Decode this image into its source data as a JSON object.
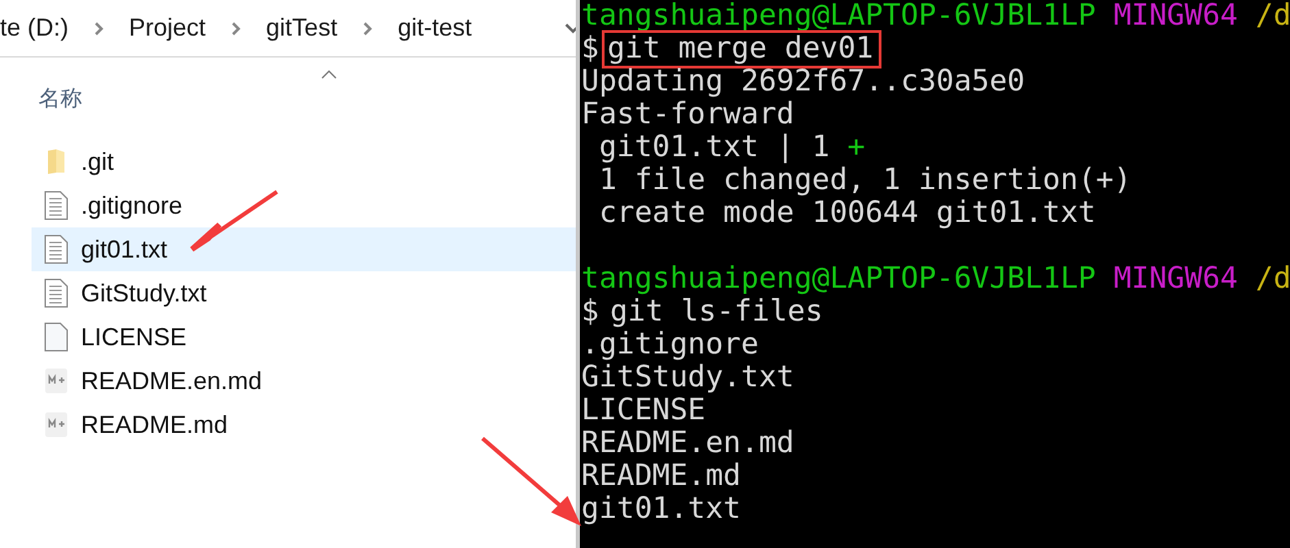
{
  "explorer": {
    "breadcrumb": [
      "te (D:)",
      "Project",
      "gitTest",
      "git-test"
    ],
    "column_header": {
      "label": "名称",
      "sorted": true
    },
    "files": [
      {
        "name": ".git",
        "kind": "folder",
        "selected": false
      },
      {
        "name": ".gitignore",
        "kind": "text",
        "selected": false
      },
      {
        "name": "git01.txt",
        "kind": "text",
        "selected": true
      },
      {
        "name": "GitStudy.txt",
        "kind": "text",
        "selected": false
      },
      {
        "name": "LICENSE",
        "kind": "blank",
        "selected": false
      },
      {
        "name": "README.en.md",
        "kind": "markdown",
        "selected": false
      },
      {
        "name": "README.md",
        "kind": "markdown",
        "selected": false
      }
    ]
  },
  "terminal": {
    "lines": [
      {
        "kind": "prompt",
        "user_host": "tangshuaipeng@LAPTOP-6VJBL1LP",
        "system": "MINGW64",
        "path": "/d"
      },
      {
        "kind": "command",
        "symbol": "$",
        "text": "git merge dev01",
        "highlighted": true
      },
      {
        "kind": "output",
        "text": "Updating 2692f67..c30a5e0"
      },
      {
        "kind": "output",
        "text": "Fast-forward"
      },
      {
        "kind": "diffstat",
        "text": " git01.txt | 1 ",
        "plus": "+"
      },
      {
        "kind": "output",
        "text": " 1 file changed, 1 insertion(+)"
      },
      {
        "kind": "output",
        "text": " create mode 100644 git01.txt"
      },
      {
        "kind": "blank"
      },
      {
        "kind": "prompt",
        "user_host": "tangshuaipeng@LAPTOP-6VJBL1LP",
        "system": "MINGW64",
        "path": "/d"
      },
      {
        "kind": "command",
        "symbol": "$",
        "text": "git ls-files",
        "highlighted": false
      },
      {
        "kind": "output",
        "text": ".gitignore"
      },
      {
        "kind": "output",
        "text": "GitStudy.txt"
      },
      {
        "kind": "output",
        "text": "LICENSE"
      },
      {
        "kind": "output",
        "text": "README.en.md"
      },
      {
        "kind": "output",
        "text": "README.md"
      },
      {
        "kind": "output",
        "text": "git01.txt"
      }
    ]
  }
}
